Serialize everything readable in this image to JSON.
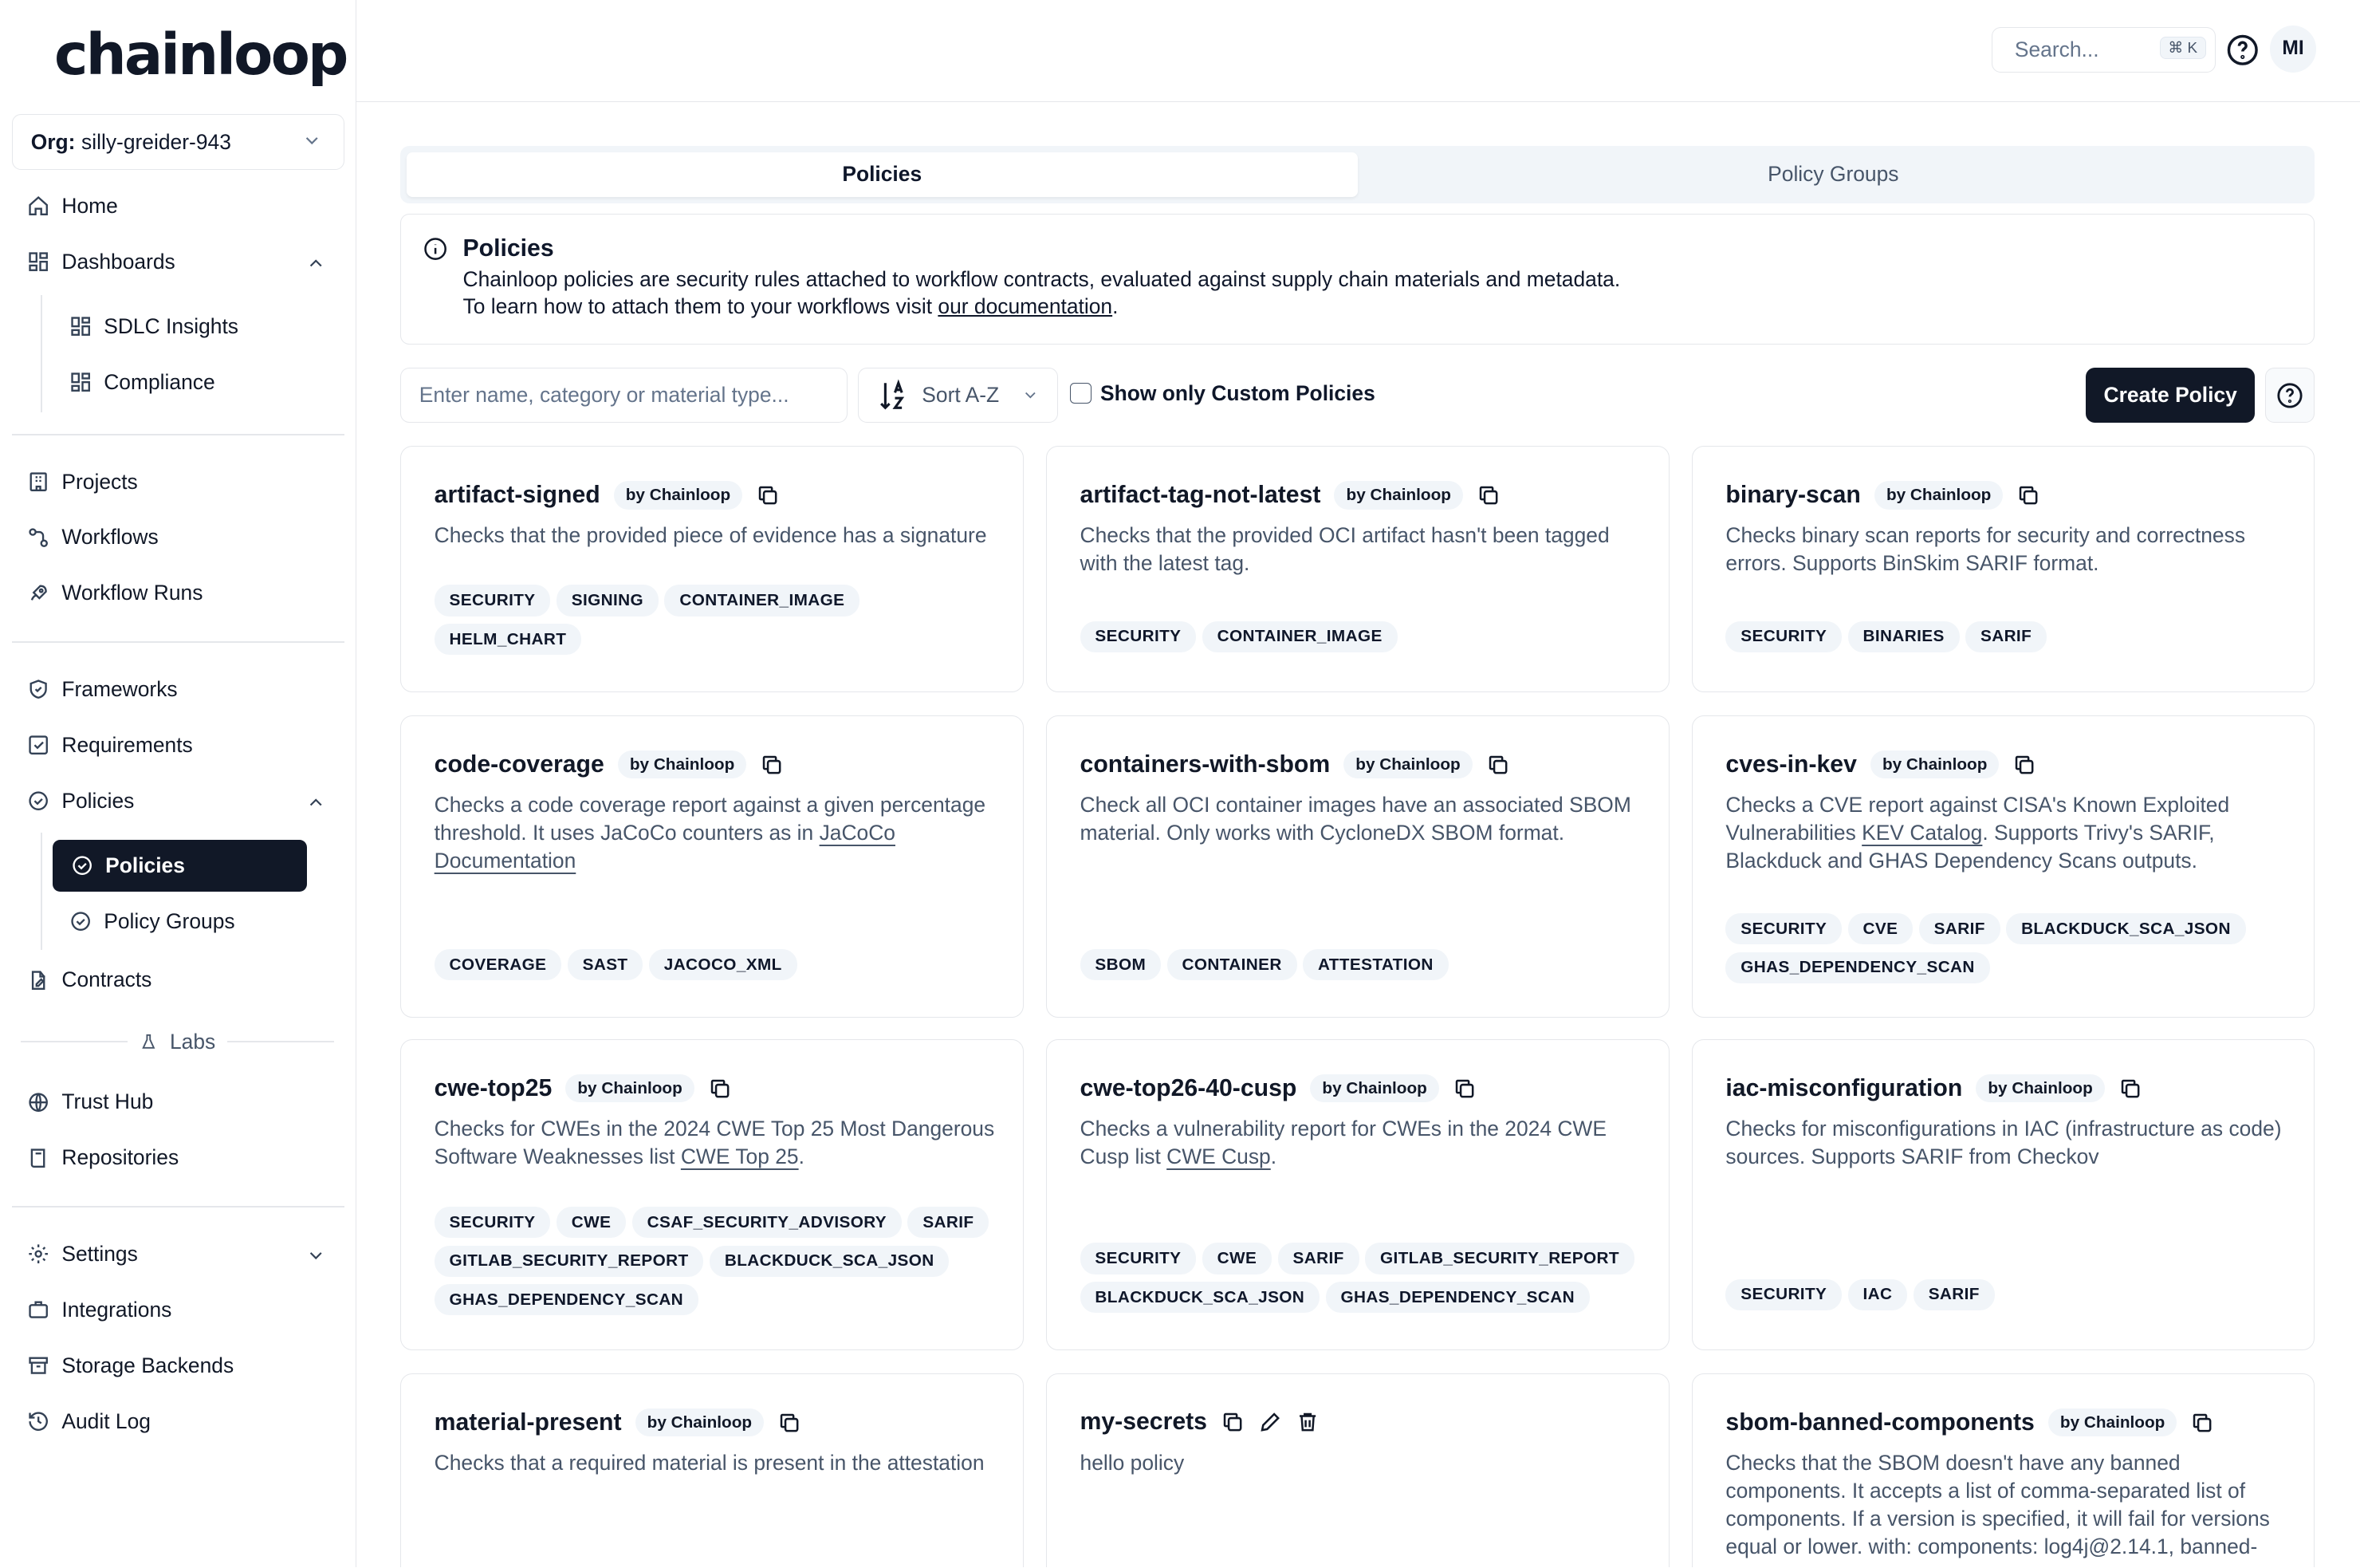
{
  "brand": {
    "logo": "chainloop"
  },
  "org": {
    "label": "Org:",
    "value": "silly-greider-943"
  },
  "nav": {
    "home": "Home",
    "dashboards": "Dashboards",
    "sdlc": "SDLC Insights",
    "compliance": "Compliance",
    "projects": "Projects",
    "workflows": "Workflows",
    "workflow_runs": "Workflow Runs",
    "frameworks": "Frameworks",
    "requirements": "Requirements",
    "policies": "Policies",
    "policies_sub": "Policies",
    "policy_groups": "Policy Groups",
    "contracts": "Contracts",
    "labs": "Labs",
    "trust_hub": "Trust Hub",
    "repositories": "Repositories",
    "settings": "Settings",
    "integrations": "Integrations",
    "storage": "Storage Backends",
    "audit": "Audit Log"
  },
  "header": {
    "search_placeholder": "Search...",
    "shortcut": "⌘ K",
    "avatar": "MI"
  },
  "tabs": {
    "policies": "Policies",
    "groups": "Policy Groups"
  },
  "info": {
    "title": "Policies",
    "line1": "Chainloop policies are security rules attached to workflow contracts, evaluated against supply chain materials and metadata.",
    "line2_prefix": "To learn how to attach them to your workflows visit ",
    "line2_link": "our documentation",
    "line2_suffix": "."
  },
  "toolbar": {
    "filter_placeholder": "Enter name, category or material type...",
    "sort": "Sort A-Z",
    "custom_only": "Show only Custom Policies",
    "create": "Create Policy"
  },
  "by_label": "by Chainloop",
  "cards": [
    {
      "name": "artifact-signed",
      "desc": "Checks that the provided piece of evidence has a signature",
      "tags": [
        "SECURITY",
        "SIGNING",
        "CONTAINER_IMAGE",
        "HELM_CHART"
      ]
    },
    {
      "name": "artifact-tag-not-latest",
      "desc": "Checks that the provided OCI artifact hasn't been tagged with the latest tag.",
      "tags": [
        "SECURITY",
        "CONTAINER_IMAGE"
      ]
    },
    {
      "name": "binary-scan",
      "desc": "Checks binary scan reports for security and correctness errors. Supports BinSkim SARIF format.",
      "tags": [
        "SECURITY",
        "BINARIES",
        "SARIF"
      ]
    },
    {
      "name": "code-coverage",
      "desc_pre": "Checks a code coverage report against a given percentage threshold. It uses JaCoCo counters as in ",
      "link": "JaCoCo Documentation",
      "desc_post": "",
      "tags": [
        "COVERAGE",
        "SAST",
        "JACOCO_XML"
      ]
    },
    {
      "name": "containers-with-sbom",
      "desc": "Check all OCI container images have an associated SBOM material. Only works with CycloneDX SBOM format.",
      "tags": [
        "SBOM",
        "CONTAINER",
        "ATTESTATION"
      ]
    },
    {
      "name": "cves-in-kev",
      "desc_pre": "Checks a CVE report against CISA's Known Exploited Vulnerabilities ",
      "link": "KEV Catalog",
      "desc_post": ". Supports Trivy's SARIF, Blackduck and GHAS Dependency Scans outputs.",
      "tags": [
        "SECURITY",
        "CVE",
        "SARIF",
        "BLACKDUCK_SCA_JSON",
        "GHAS_DEPENDENCY_SCAN"
      ]
    },
    {
      "name": "cwe-top25",
      "desc_pre": "Checks for CWEs in the 2024 CWE Top 25 Most Dangerous Software Weaknesses list ",
      "link": "CWE Top 25",
      "desc_post": ".",
      "tags": [
        "SECURITY",
        "CWE",
        "CSAF_SECURITY_ADVISORY",
        "SARIF",
        "GITLAB_SECURITY_REPORT",
        "BLACKDUCK_SCA_JSON",
        "GHAS_DEPENDENCY_SCAN"
      ]
    },
    {
      "name": "cwe-top26-40-cusp",
      "desc_pre": "Checks a vulnerability report for CWEs in the 2024 CWE Cusp list ",
      "link": "CWE Cusp",
      "desc_post": ".",
      "tags": [
        "SECURITY",
        "CWE",
        "SARIF",
        "GITLAB_SECURITY_REPORT",
        "BLACKDUCK_SCA_JSON",
        "GHAS_DEPENDENCY_SCAN"
      ]
    },
    {
      "name": "iac-misconfiguration",
      "desc": "Checks for misconfigurations in IAC (infrastructure as code) sources. Supports SARIF from Checkov",
      "tags": [
        "SECURITY",
        "IAC",
        "SARIF"
      ]
    },
    {
      "name": "material-present",
      "desc": "Checks that a required material is present in the attestation",
      "tags": []
    },
    {
      "name": "my-secrets",
      "desc": "hello policy",
      "tags": []
    },
    {
      "name": "sbom-banned-components",
      "desc": "Checks that the SBOM doesn't have any banned components. It accepts a list of comma-separated list of components. If a version is specified, it will fail for versions equal or lower. with: components: log4j@2.14.1, banned-",
      "tags": []
    }
  ]
}
